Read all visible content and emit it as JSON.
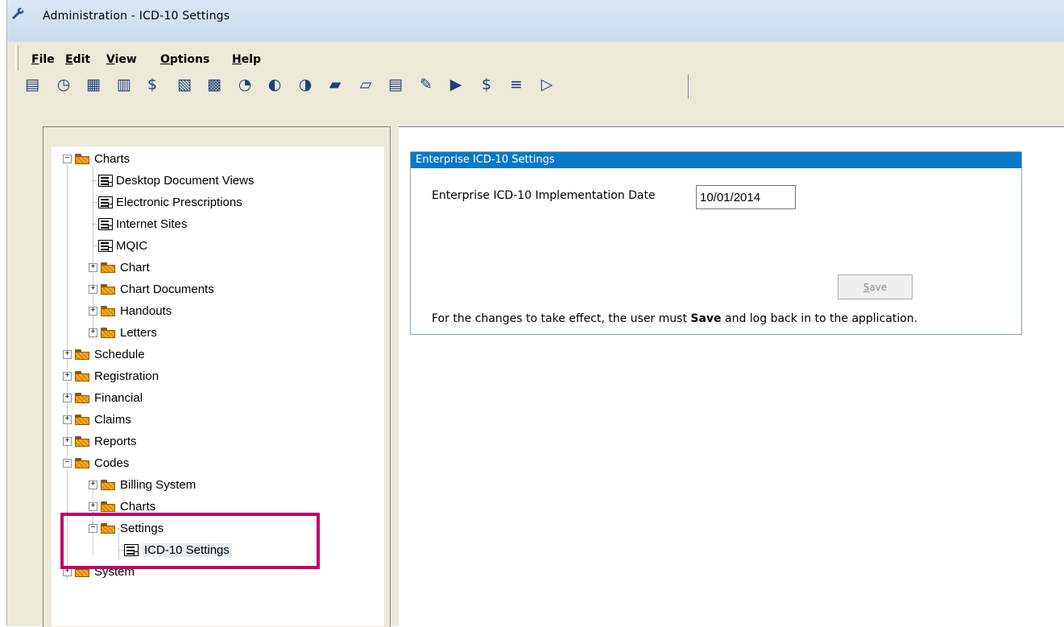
{
  "window": {
    "title": "Administration - ICD-10 Settings"
  },
  "menu": [
    {
      "accel": "F",
      "rest": "ile"
    },
    {
      "accel": "E",
      "rest": "dit"
    },
    {
      "accel": "V",
      "rest": "iew"
    },
    {
      "accel": "O",
      "rest": "ptions"
    },
    {
      "accel": "H",
      "rest": "elp"
    }
  ],
  "toolbar": {
    "icons": [
      "list-icon",
      "timer-icon",
      "checklist-icon",
      "schedule-icon",
      "dollar-icon",
      "billing-icon",
      "calculator-icon",
      "user-transfer-icon",
      "search-user-icon",
      "search-money-icon",
      "folder-import-icon",
      "folder-open-icon",
      "document-icon",
      "wrench-icon",
      "billing-transfer-icon",
      "cost-chart-icon",
      "form-check-icon",
      "exit-icon"
    ],
    "glyphs": [
      "▤",
      "◷",
      "▦",
      "▥",
      "$",
      "▧",
      "▩",
      "◔",
      "◐",
      "◑",
      "▰",
      "▱",
      "▤",
      "✎",
      "▶",
      "$",
      "≡",
      "▷"
    ],
    "colors": {
      "icon": "#1f3f7a"
    }
  },
  "tree": {
    "items": [
      {
        "label": "Charts",
        "type": "folder",
        "expander": "−"
      },
      {
        "label": "Desktop Document Views",
        "type": "doc"
      },
      {
        "label": "Electronic Prescriptions",
        "type": "doc"
      },
      {
        "label": "Internet Sites",
        "type": "doc"
      },
      {
        "label": "MQIC",
        "type": "doc"
      },
      {
        "label": "Chart",
        "type": "folder",
        "expander": "+"
      },
      {
        "label": "Chart Documents",
        "type": "folder",
        "expander": "+"
      },
      {
        "label": "Handouts",
        "type": "folder",
        "expander": "+"
      },
      {
        "label": "Letters",
        "type": "folder",
        "expander": "+"
      },
      {
        "label": "Schedule",
        "type": "folder",
        "expander": "+"
      },
      {
        "label": "Registration",
        "type": "folder",
        "expander": "+"
      },
      {
        "label": "Financial",
        "type": "folder",
        "expander": "+"
      },
      {
        "label": "Claims",
        "type": "folder",
        "expander": "+"
      },
      {
        "label": "Reports",
        "type": "folder",
        "expander": "+"
      },
      {
        "label": "Codes",
        "type": "folder",
        "expander": "−"
      },
      {
        "label": "Billing System",
        "type": "folder",
        "expander": "+"
      },
      {
        "label": "Charts",
        "type": "folder",
        "expander": "+"
      },
      {
        "label": "Settings",
        "type": "folder",
        "expander": "−"
      },
      {
        "label": "ICD-10 Settings",
        "type": "doc",
        "selected": true
      },
      {
        "label": "System",
        "type": "folder",
        "expander": "+"
      }
    ]
  },
  "panel": {
    "header": "Enterprise ICD-10 Settings",
    "date_label": "Enterprise ICD-10 Implementation Date",
    "date_value": "10/01/2014",
    "save_accel": "S",
    "save_rest": "ave",
    "note_before": "For the changes to take effect, the user must ",
    "note_bold": "Save",
    "note_after": " and log back in to the application."
  },
  "colors": {
    "highlight": "#c0006d",
    "panel_header": "#0a78c8"
  }
}
